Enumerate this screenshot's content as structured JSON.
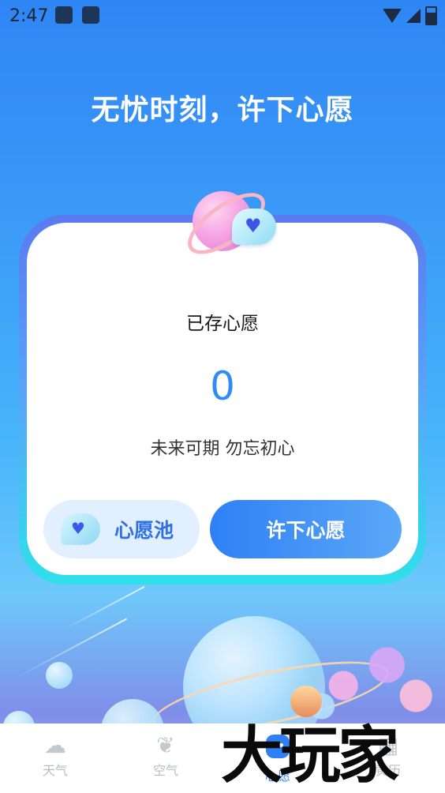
{
  "status_bar": {
    "time": "2:47"
  },
  "headline": "无忧时刻，许下心愿",
  "card": {
    "title": "已存心愿",
    "count": "0",
    "motto": "未来可期  勿忘初心",
    "pool_button": "心愿池",
    "wish_button": "许下心愿"
  },
  "nav": {
    "items": [
      {
        "label": "天气",
        "icon": "cloud-icon"
      },
      {
        "label": "空气",
        "icon": "leaf-icon"
      },
      {
        "label": "心愿",
        "icon": "wish-face-icon",
        "active": true
      },
      {
        "label": "黄历",
        "icon": "calendar-icon"
      }
    ]
  },
  "watermark": "大玩家",
  "colors": {
    "accent": "#2f80f5",
    "card_border": "#5a7af0"
  }
}
